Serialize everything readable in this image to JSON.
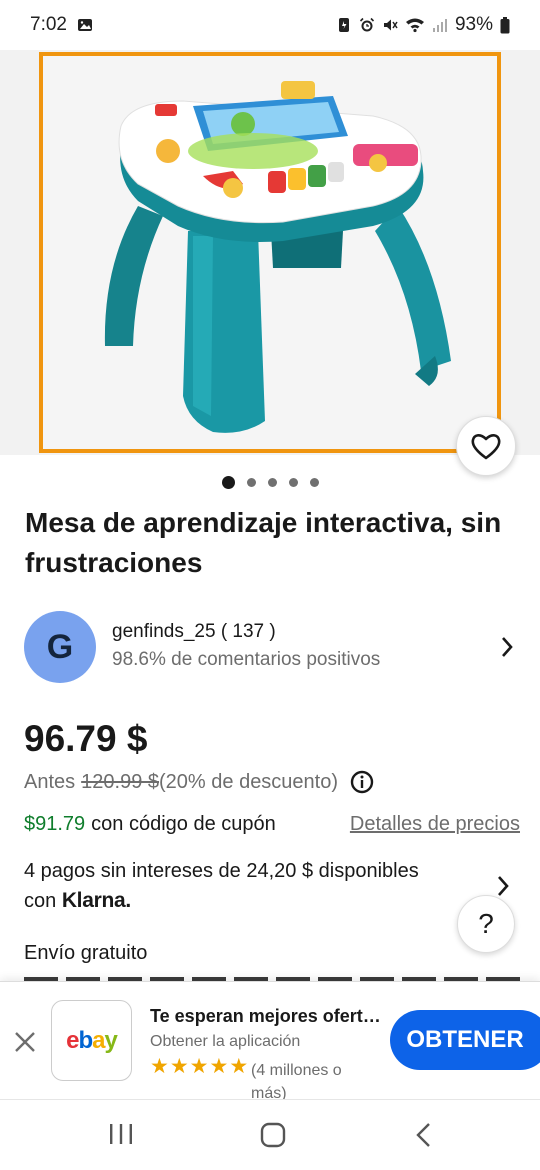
{
  "status_bar": {
    "time": "7:02",
    "battery": "93%"
  },
  "product": {
    "title": "Mesa de aprendizaje interactiva, sin frustraciones",
    "image_count": 5,
    "active_image": 1
  },
  "seller": {
    "avatar_letter": "G",
    "name": "genfinds_25 ( 137 )",
    "feedback": "98.6% de comentarios positivos"
  },
  "pricing": {
    "price": "96.79 $",
    "was_label": "Antes",
    "was_price": "120.99 $",
    "discount": "(20% de descuento)",
    "coupon_price": "$91.79",
    "coupon_text": "con código de cupón",
    "details_link": "Detalles de precios"
  },
  "klarna": {
    "text": "4 pagos sin intereses de 24,20 $ disponibles",
    "with": "con",
    "logo": "Klarna."
  },
  "shipping": {
    "label": "Envío gratuito"
  },
  "help": {
    "label": "?"
  },
  "app_banner": {
    "app_logo": "ebay",
    "title": "Te esperan mejores ofert…",
    "subtitle": "Obtener la aplicación",
    "rating": 5,
    "reviews": "(4 millones o más)",
    "button": "OBTENER"
  },
  "colors": {
    "frame": "#f0950f",
    "coupon": "#0f7d2c",
    "button": "#0d63e8",
    "avatar": "#79a2ee",
    "star": "#f0a500"
  }
}
